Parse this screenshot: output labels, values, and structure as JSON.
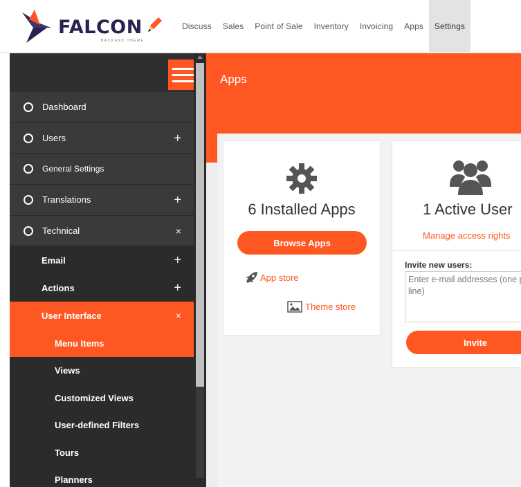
{
  "brand": {
    "name": "FALCON",
    "tagline": "BACKEND THEME",
    "accent": "#ff5722",
    "dark": "#2b2252"
  },
  "nav": {
    "items": [
      "Discuss",
      "Sales",
      "Point of Sale",
      "Inventory",
      "Invoicing",
      "Apps",
      "Settings"
    ],
    "active": "Settings"
  },
  "sidebar": {
    "toggle_icon": "hamburger-icon",
    "items": [
      {
        "label": "Dashboard",
        "level": 1,
        "control": ""
      },
      {
        "label": "Users",
        "level": 1,
        "control": "+"
      },
      {
        "label": "General Settings",
        "level": 1,
        "control": ""
      },
      {
        "label": "Translations",
        "level": 1,
        "control": "+"
      },
      {
        "label": "Technical",
        "level": 1,
        "control": "×"
      },
      {
        "label": "Email",
        "level": 2,
        "control": "+"
      },
      {
        "label": "Actions",
        "level": 2,
        "control": "+"
      },
      {
        "label": "User Interface",
        "level": 2,
        "control": "×"
      },
      {
        "label": "Menu Items",
        "level": 3,
        "control": ""
      },
      {
        "label": "Views",
        "level": 3,
        "control": ""
      },
      {
        "label": "Customized Views",
        "level": 3,
        "control": ""
      },
      {
        "label": "User-defined Filters",
        "level": 3,
        "control": ""
      },
      {
        "label": "Tours",
        "level": 3,
        "control": ""
      },
      {
        "label": "Planners",
        "level": 3,
        "control": ""
      }
    ]
  },
  "main": {
    "title": "Apps",
    "apps_card": {
      "icon": "gear-icon",
      "count_label": "6 Installed Apps",
      "browse_button": "Browse Apps",
      "app_store_link": "App store",
      "theme_store_link": "Theme store"
    },
    "users_card": {
      "icon": "users-icon",
      "count_label": "1 Active User",
      "manage_link": "Manage access rights",
      "invite_label": "Invite new users:",
      "invite_placeholder": "Enter e-mail addresses (one per line)",
      "invite_button": "Invite"
    }
  }
}
